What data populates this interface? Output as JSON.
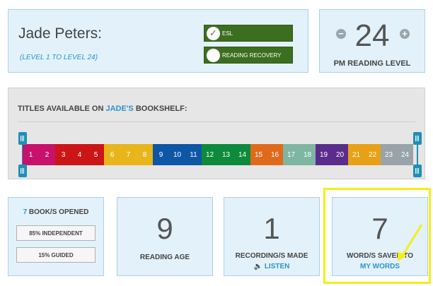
{
  "student": {
    "name": "Jade Peters:",
    "level_range": "(LEVEL 1 TO LEVEL 24)",
    "esl_label": "ESL",
    "reading_recovery_label": "READING RECOVERY"
  },
  "pm_level": {
    "value": "24",
    "label": "PM READING LEVEL",
    "minus": "−",
    "plus": "+"
  },
  "bookshelf": {
    "title_prefix": "TITLES AVAILABLE ON ",
    "title_name": "JADE'S",
    "title_suffix": " BOOKSHELF:",
    "levels": [
      {
        "label": "1",
        "color": "#c8116a"
      },
      {
        "label": "2",
        "color": "#c8116a"
      },
      {
        "label": "3",
        "color": "#cc1517"
      },
      {
        "label": "4",
        "color": "#cc1517"
      },
      {
        "label": "5",
        "color": "#cc1517"
      },
      {
        "label": "6",
        "color": "#e8b51b"
      },
      {
        "label": "7",
        "color": "#e8b51b"
      },
      {
        "label": "8",
        "color": "#e8b51b"
      },
      {
        "label": "9",
        "color": "#0e56a6"
      },
      {
        "label": "10",
        "color": "#0e56a6"
      },
      {
        "label": "11",
        "color": "#0e56a6"
      },
      {
        "label": "12",
        "color": "#0d8a3c"
      },
      {
        "label": "13",
        "color": "#0d8a3c"
      },
      {
        "label": "14",
        "color": "#0d8a3c"
      },
      {
        "label": "15",
        "color": "#e06a1c"
      },
      {
        "label": "16",
        "color": "#e06a1c"
      },
      {
        "label": "17",
        "color": "#7fb5a3"
      },
      {
        "label": "18",
        "color": "#7fb5a3"
      },
      {
        "label": "19",
        "color": "#5a2d8c"
      },
      {
        "label": "20",
        "color": "#5a2d8c"
      },
      {
        "label": "21",
        "color": "#e8a116"
      },
      {
        "label": "22",
        "color": "#e8a116"
      },
      {
        "label": "23",
        "color": "#99a3aa"
      },
      {
        "label": "24",
        "color": "#99a3aa"
      }
    ]
  },
  "stats": {
    "books_count": "7",
    "books_label": " BOOK/S OPENED",
    "independent": "85% INDEPENDENT",
    "guided": "15% GUIDED",
    "reading_age_value": "9",
    "reading_age_label": "READING AGE",
    "recordings_value": "1",
    "recordings_label": "RECORDING/S MADE",
    "listen_label": "LISTEN",
    "words_value": "7",
    "words_label": "WORD/S SAVED TO",
    "my_words_label": "MY WORDS"
  },
  "colors": {
    "accent_blue": "#2a94d0",
    "card_bg": "#e3f1fa",
    "toggle_green": "#3c6e1f",
    "highlight_yellow": "#f4ef16"
  }
}
